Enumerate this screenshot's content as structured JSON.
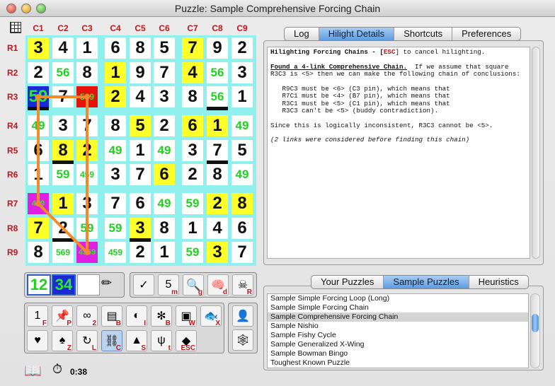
{
  "window": {
    "title": "Puzzle: Sample Comprehensive Forcing Chain"
  },
  "columns": [
    "C1",
    "C2",
    "C3",
    "C4",
    "C5",
    "C6",
    "C7",
    "C8",
    "C9"
  ],
  "rows": [
    "R1",
    "R2",
    "R3",
    "R4",
    "R5",
    "R6",
    "R7",
    "R8",
    "R9"
  ],
  "board": [
    [
      "3",
      "4",
      "1",
      "6",
      "8",
      "5",
      "7",
      "9",
      "2"
    ],
    [
      "2",
      "56",
      "8",
      "1",
      "9",
      "7",
      "4",
      "56",
      "3"
    ],
    [
      "59",
      "7",
      "569",
      "2",
      "4",
      "3",
      "8",
      "56",
      "1"
    ],
    [
      "49",
      "3",
      "7",
      "8",
      "5",
      "2",
      "6",
      "1",
      "49"
    ],
    [
      "6",
      "8",
      "2",
      "49",
      "1",
      "49",
      "3",
      "7",
      "5"
    ],
    [
      "1",
      "59",
      "459",
      "3",
      "7",
      "6",
      "2",
      "8",
      "49"
    ],
    [
      "459",
      "1",
      "3",
      "7",
      "6",
      "49",
      "59",
      "2",
      "8"
    ],
    [
      "7",
      "2",
      "59",
      "59",
      "3",
      "8",
      "1",
      "4",
      "6"
    ],
    [
      "8",
      "569",
      "4569",
      "459",
      "2",
      "1",
      "59",
      "3",
      "7"
    ]
  ],
  "cell_colors": [
    [
      "y",
      "w",
      "w",
      "w",
      "w",
      "w",
      "y",
      "w",
      "w"
    ],
    [
      "w",
      "w",
      "w",
      "y",
      "w",
      "w",
      "y",
      "w",
      "w"
    ],
    [
      "b",
      "w",
      "r",
      "y",
      "w",
      "w",
      "w",
      "w",
      "w"
    ],
    [
      "w",
      "w",
      "w",
      "w",
      "y",
      "w",
      "y",
      "y",
      "w"
    ],
    [
      "w",
      "y",
      "y",
      "w",
      "w",
      "w",
      "w",
      "w",
      "w"
    ],
    [
      "w",
      "w",
      "w",
      "w",
      "w",
      "y",
      "w",
      "w",
      "w"
    ],
    [
      "m",
      "y",
      "w",
      "w",
      "w",
      "w",
      "w",
      "y",
      "y"
    ],
    [
      "y",
      "w",
      "w",
      "w",
      "y",
      "w",
      "w",
      "w",
      "w"
    ],
    [
      "w",
      "w",
      "m",
      "w",
      "w",
      "w",
      "w",
      "y",
      "w"
    ]
  ],
  "chain_links": [
    [
      3,
      1,
      3,
      3
    ],
    [
      3,
      3,
      9,
      3
    ],
    [
      9,
      3,
      7,
      1
    ],
    [
      7,
      1,
      3,
      1
    ]
  ],
  "top_tabs": {
    "items": [
      "Log",
      "Hilight Details",
      "Shortcuts",
      "Preferences"
    ],
    "active": 1
  },
  "detail": {
    "heading": "Hilighting Forcing Chains - [",
    "esc_key": "ESC",
    "heading_tail": "] to cancel hilighting.",
    "found": "Found a 4-link Comprehensive Chain.",
    "found_tail": "  If we assume that square R3C3 is <5> then we can make the following chain of conclusions:",
    "chain_lines": "   R9C3 must be <6> (C3 pin), which means that\n   R7C1 must be <4> (B7 pin), which means that\n   R3C1 must be <5> (C1 pin), which means that\n   R3C3 can't be <5> (buddy contradiction).",
    "conclusion": "Since this is logically inconsistent, R3C3 cannot be <5>.",
    "note": "(2 links were considered before finding this chain)"
  },
  "bottom_tabs": {
    "items": [
      "Your Puzzles",
      "Sample Puzzles",
      "Heuristics"
    ],
    "active": 1
  },
  "puzzles": {
    "items": [
      "Sample Simple Forcing Loop (Long)",
      "Sample Simple Forcing Chain",
      "Sample Comprehensive Forcing Chain",
      "Sample Nishio",
      "Sample Fishy Cycle",
      "Sample Generalized X-Wing",
      "Sample Bowman Bingo",
      "Toughest Known Puzzle"
    ],
    "selected": 2
  },
  "counters": {
    "left": "12",
    "right": "34"
  },
  "tools_row1": [
    {
      "name": "check-tool",
      "glyph": "✓",
      "key": ""
    },
    {
      "name": "mark-tool",
      "glyph": "5",
      "key": "m"
    },
    {
      "name": "magnify-tool",
      "glyph": "🔍",
      "key": "g"
    },
    {
      "name": "brain-tool",
      "glyph": "🧠",
      "key": "d"
    },
    {
      "name": "skull-tool",
      "glyph": "☠",
      "key": "R"
    }
  ],
  "tools_grid": [
    {
      "name": "forcing-tool",
      "glyph": "1",
      "key": "F"
    },
    {
      "name": "pin-tool",
      "glyph": "📌",
      "key": "P"
    },
    {
      "name": "pair-tool",
      "glyph": "∞",
      "key": "2"
    },
    {
      "name": "box-tool",
      "glyph": "▤",
      "key": "B"
    },
    {
      "name": "circle-tool",
      "glyph": "◐",
      "key": "I"
    },
    {
      "name": "bug-tool",
      "glyph": "✻",
      "key": "B"
    },
    {
      "name": "wing-tool",
      "glyph": "▣",
      "key": "W"
    },
    {
      "name": "fish-tool",
      "glyph": "🐟",
      "key": "X"
    },
    {
      "name": "bird-tool",
      "glyph": "♥",
      "key": ""
    },
    {
      "name": "leap-tool",
      "glyph": "♠",
      "key": "Z"
    },
    {
      "name": "loop-tool",
      "glyph": "↻",
      "key": "L"
    },
    {
      "name": "chain-tool",
      "glyph": "⛓",
      "key": "C"
    },
    {
      "name": "shapes-tool",
      "glyph": "▲",
      "key": "S"
    },
    {
      "name": "grass-tool",
      "glyph": "ψ",
      "key": "t"
    },
    {
      "name": "eraser-tool",
      "glyph": "◆",
      "key": "ESC"
    }
  ],
  "timer": "0:38"
}
